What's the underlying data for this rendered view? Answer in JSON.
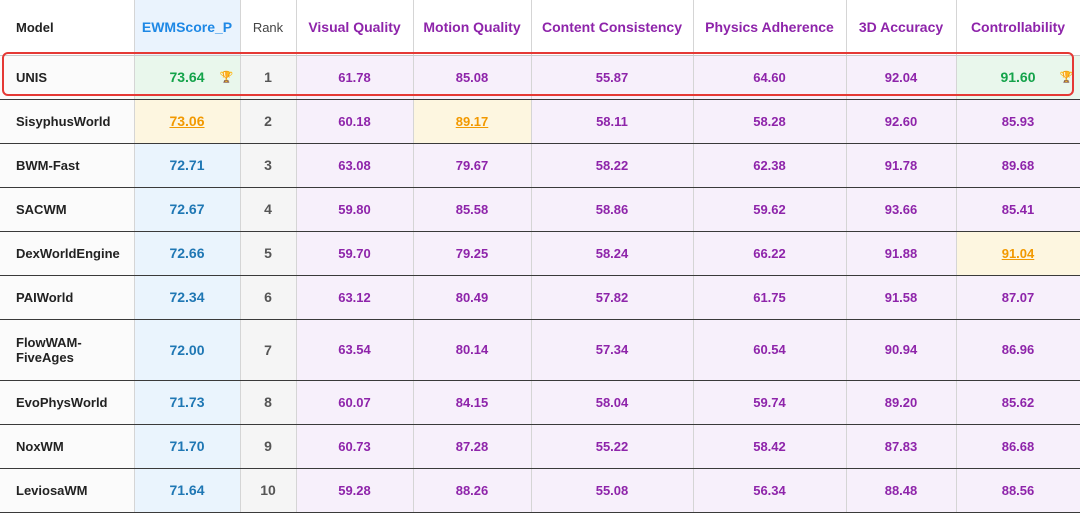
{
  "headers": {
    "model": "Model",
    "score": "EWMScore_P",
    "rank": "Rank",
    "visual": "Visual Quality",
    "motion": "Motion Quality",
    "content": "Content Consistency",
    "physics": "Physics Adherence",
    "accuracy": "3D Accuracy",
    "control": "Controllability"
  },
  "icons": {
    "trophy": "trophy-icon"
  },
  "colors": {
    "best": "#14a34a",
    "second": "#f29900",
    "metric": "#8e24aa",
    "score": "#1f77b4",
    "highlight": "#e53935"
  },
  "rows": [
    {
      "model": "UNIS",
      "score": "73.64",
      "rank": "1",
      "visual": "61.78",
      "motion": "85.08",
      "content": "55.87",
      "physics": "64.60",
      "accuracy": "92.04",
      "control": "91.60"
    },
    {
      "model": "SisyphusWorld",
      "score": "73.06",
      "rank": "2",
      "visual": "60.18",
      "motion": "89.17",
      "content": "58.11",
      "physics": "58.28",
      "accuracy": "92.60",
      "control": "85.93"
    },
    {
      "model": "BWM-Fast",
      "score": "72.71",
      "rank": "3",
      "visual": "63.08",
      "motion": "79.67",
      "content": "58.22",
      "physics": "62.38",
      "accuracy": "91.78",
      "control": "89.68"
    },
    {
      "model": "SACWM",
      "score": "72.67",
      "rank": "4",
      "visual": "59.80",
      "motion": "85.58",
      "content": "58.86",
      "physics": "59.62",
      "accuracy": "93.66",
      "control": "85.41"
    },
    {
      "model": "DexWorldEngine",
      "score": "72.66",
      "rank": "5",
      "visual": "59.70",
      "motion": "79.25",
      "content": "58.24",
      "physics": "66.22",
      "accuracy": "91.88",
      "control": "91.04"
    },
    {
      "model": "PAIWorld",
      "score": "72.34",
      "rank": "6",
      "visual": "63.12",
      "motion": "80.49",
      "content": "57.82",
      "physics": "61.75",
      "accuracy": "91.58",
      "control": "87.07"
    },
    {
      "model": "FlowWAM-FiveAges",
      "score": "72.00",
      "rank": "7",
      "visual": "63.54",
      "motion": "80.14",
      "content": "57.34",
      "physics": "60.54",
      "accuracy": "90.94",
      "control": "86.96"
    },
    {
      "model": "EvoPhysWorld",
      "score": "71.73",
      "rank": "8",
      "visual": "60.07",
      "motion": "84.15",
      "content": "58.04",
      "physics": "59.74",
      "accuracy": "89.20",
      "control": "85.62"
    },
    {
      "model": "NoxWM",
      "score": "71.70",
      "rank": "9",
      "visual": "60.73",
      "motion": "87.28",
      "content": "55.22",
      "physics": "58.42",
      "accuracy": "87.83",
      "control": "86.68"
    },
    {
      "model": "LeviosaWM",
      "score": "71.64",
      "rank": "10",
      "visual": "59.28",
      "motion": "88.26",
      "content": "55.08",
      "physics": "56.34",
      "accuracy": "88.48",
      "control": "88.56"
    }
  ]
}
